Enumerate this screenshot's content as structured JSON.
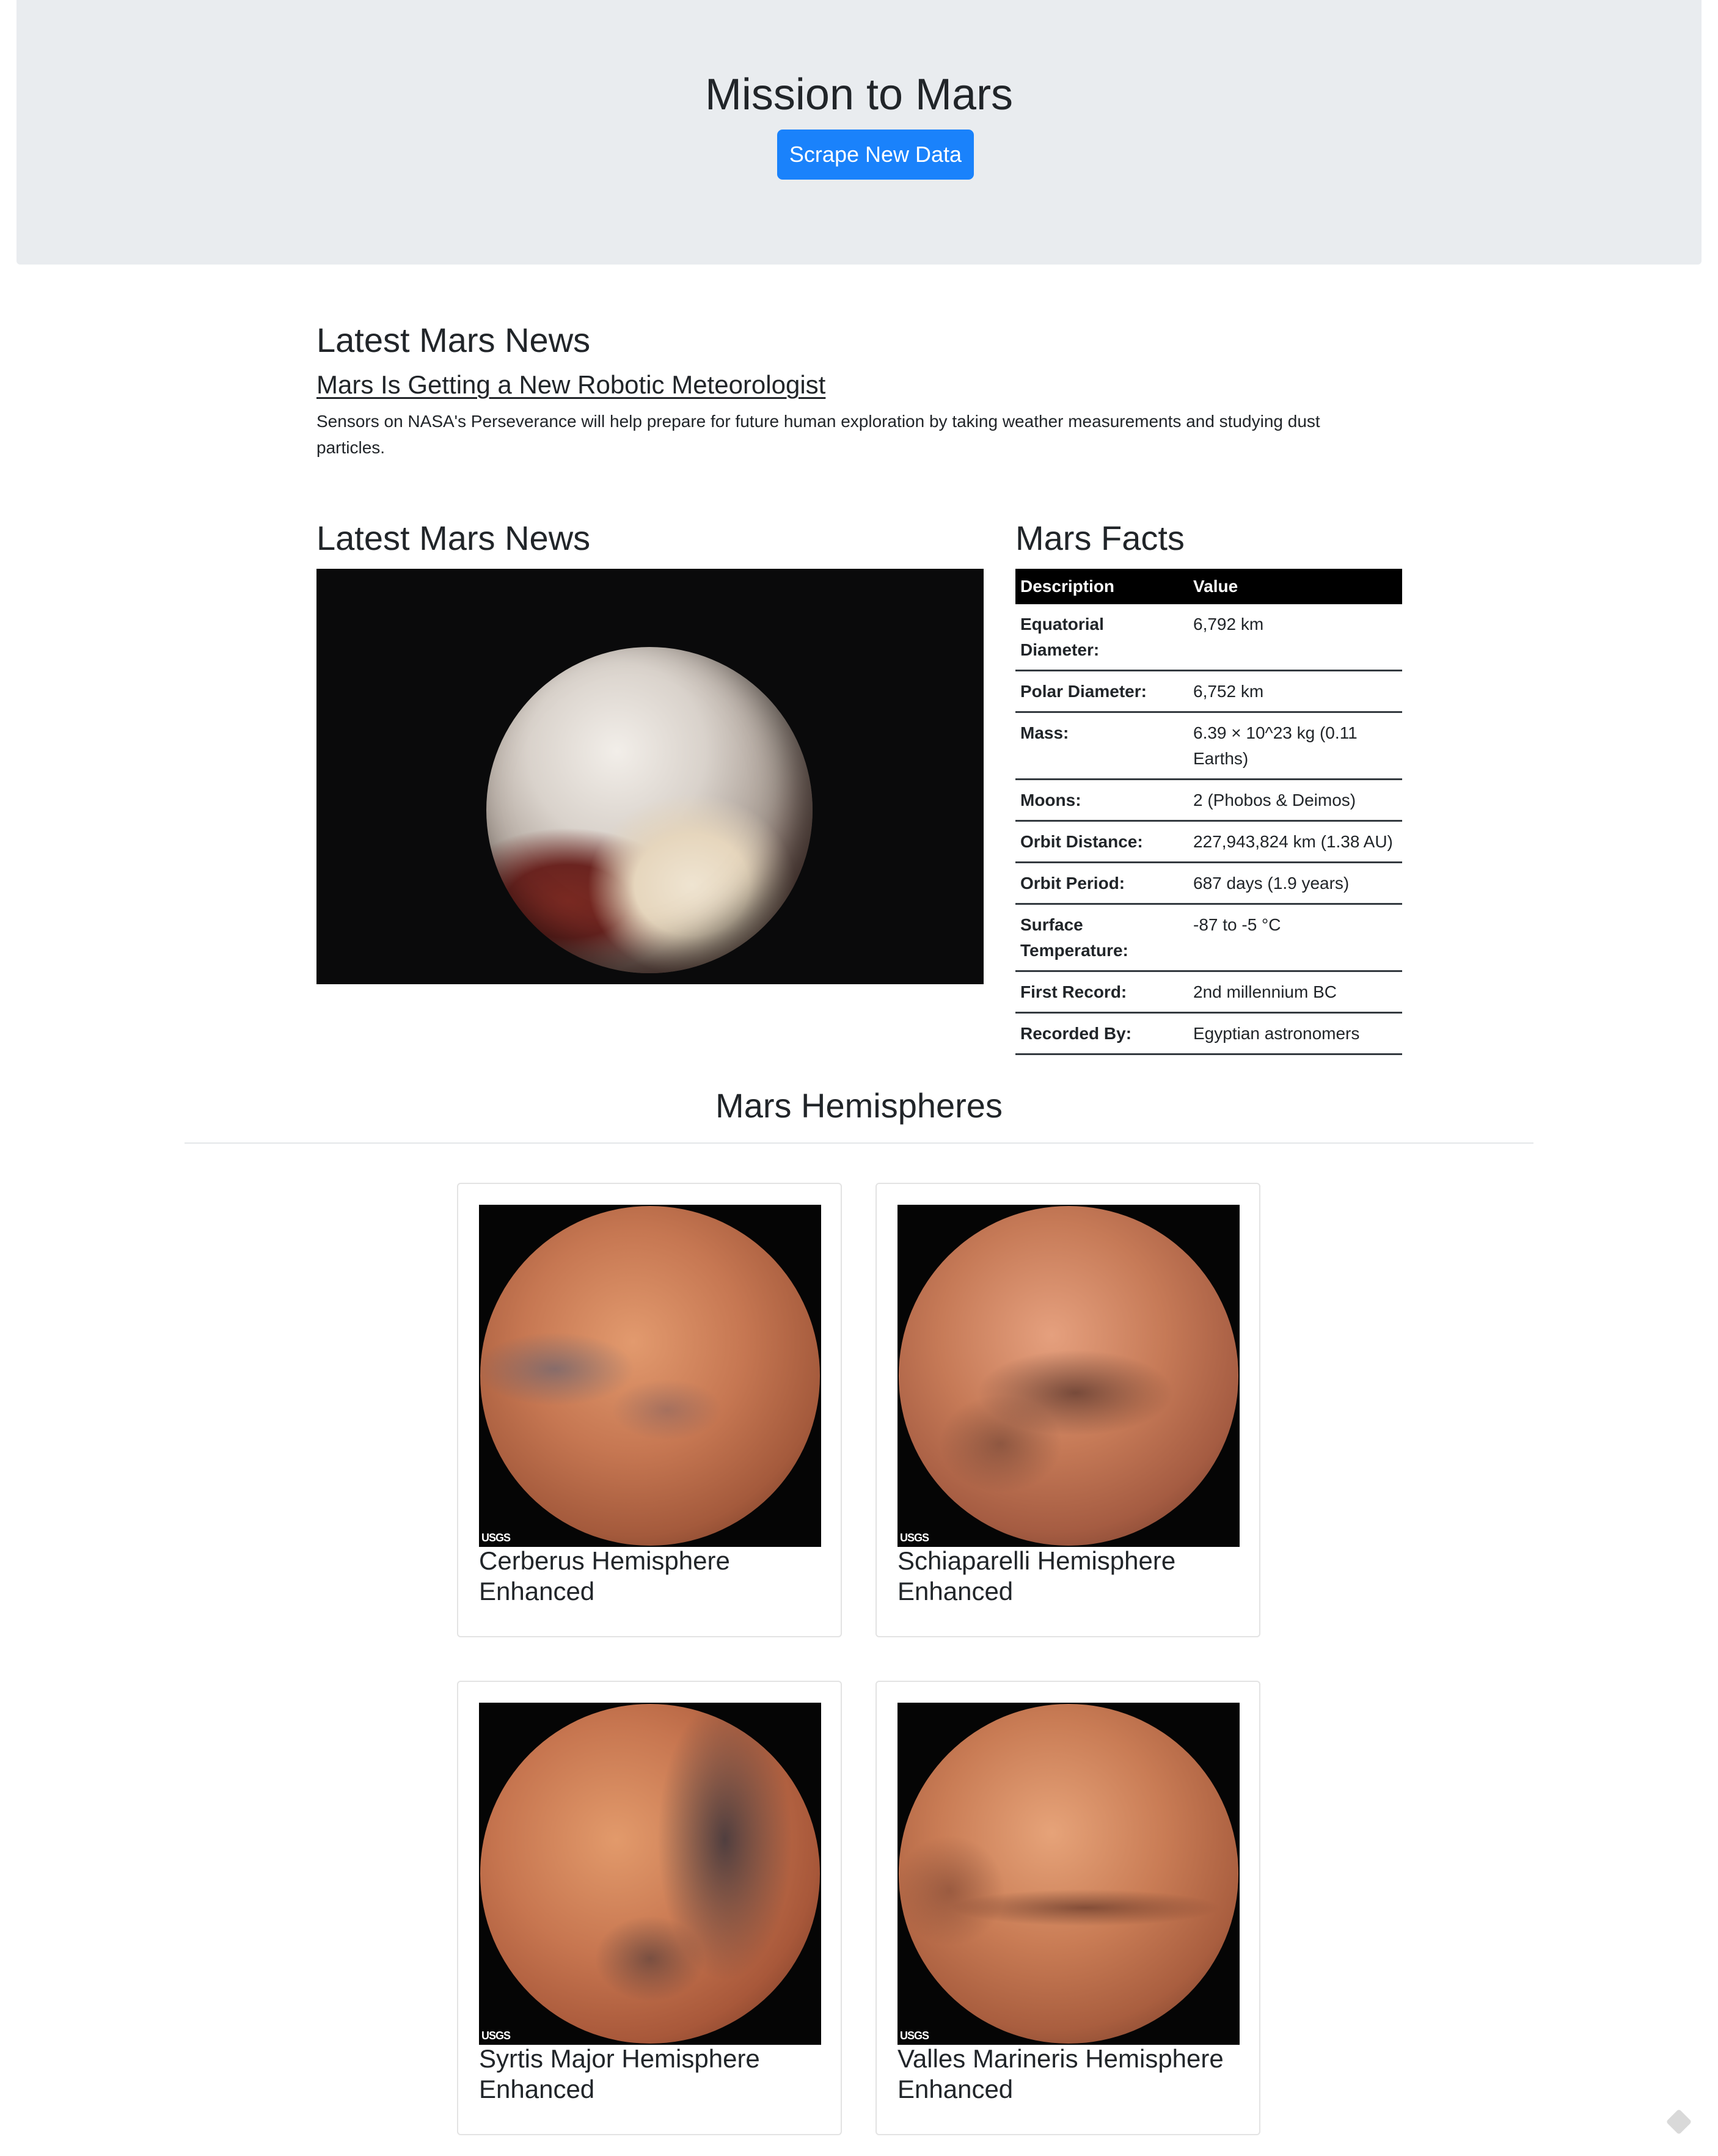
{
  "jumbotron": {
    "title": "Mission to Mars",
    "scrape_button": "Scrape New Data"
  },
  "news": {
    "heading": "Latest Mars News",
    "title": "Mars Is Getting a New Robotic Meteorologist",
    "teaser": "Sensors on NASA's Perseverance will help prepare for future human exploration by taking weather measurements and studying dust particles."
  },
  "featured": {
    "heading": "Latest Mars News"
  },
  "facts": {
    "heading": "Mars Facts",
    "columns": [
      "Description",
      "Value"
    ],
    "rows": [
      {
        "desc": "Equatorial Diameter:",
        "value": "6,792 km"
      },
      {
        "desc": "Polar Diameter:",
        "value": "6,752 km"
      },
      {
        "desc": "Mass:",
        "value": "6.39 × 10^23 kg (0.11 Earths)"
      },
      {
        "desc": "Moons:",
        "value": "2 (Phobos & Deimos)"
      },
      {
        "desc": "Orbit Distance:",
        "value": "227,943,824 km (1.38 AU)"
      },
      {
        "desc": "Orbit Period:",
        "value": "687 days (1.9 years)"
      },
      {
        "desc": "Surface Temperature:",
        "value": "-87 to -5 °C"
      },
      {
        "desc": "First Record:",
        "value": "2nd millennium BC"
      },
      {
        "desc": "Recorded By:",
        "value": "Egyptian astronomers"
      }
    ]
  },
  "hemispheres": {
    "heading": "Mars Hemispheres",
    "items": [
      {
        "title": "Cerberus Hemisphere Enhanced",
        "image_label": "USGS"
      },
      {
        "title": "Schiaparelli Hemisphere Enhanced",
        "image_label": "USGS"
      },
      {
        "title": "Syrtis Major Hemisphere Enhanced",
        "image_label": "USGS"
      },
      {
        "title": "Valles Marineris Hemisphere Enhanced",
        "image_label": "USGS"
      }
    ]
  },
  "colors": {
    "accent": "#1a82fb",
    "jumbotron_bg": "#e9ecef",
    "table_header_bg": "#000000"
  }
}
